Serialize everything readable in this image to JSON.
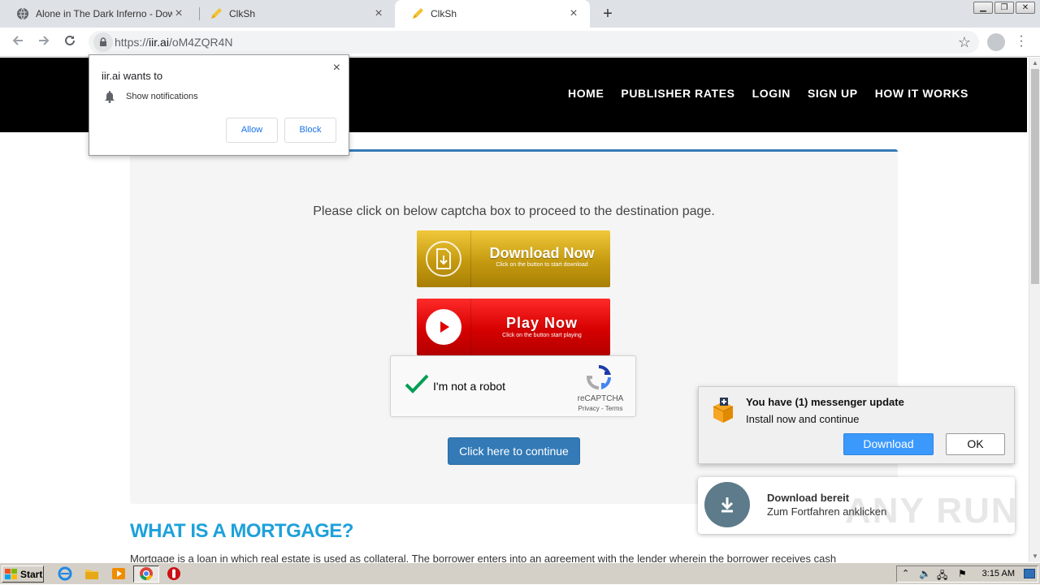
{
  "browser": {
    "tabs": [
      {
        "title": "Alone in The Dark Inferno - Download",
        "close": "×"
      },
      {
        "title": "ClkSh",
        "close": "×"
      },
      {
        "title": "ClkSh",
        "close": "×"
      }
    ],
    "new_tab": "+",
    "url_scheme": "https://",
    "url_host": "iir.ai",
    "url_path": "/oM4ZQR4N",
    "window_buttons": [
      "▁",
      "❐",
      "✕"
    ]
  },
  "site": {
    "nav": [
      "HOME",
      "PUBLISHER RATES",
      "LOGIN",
      "SIGN UP",
      "HOW IT WORKS"
    ]
  },
  "panel": {
    "instruction": "Please click on below captcha box to proceed to the destination page.",
    "download_btn": {
      "title": "Download Now",
      "subtitle": "Click on the button to start download"
    },
    "play_btn": {
      "title": "Play Now",
      "subtitle": "Click on the button start playing"
    },
    "captcha": {
      "label": "I'm not a robot",
      "brand": "reCAPTCHA",
      "terms": "Privacy - Terms"
    },
    "continue": "Click here to continue"
  },
  "article": {
    "heading": "WHAT IS A MORTGAGE?",
    "text": "Mortgage is a loan in which real estate is used as collateral. The borrower enters into an agreement with the lender wherein the borrower receives cash"
  },
  "permission": {
    "title": "iir.ai wants to",
    "text": "Show notifications",
    "allow": "Allow",
    "block": "Block",
    "close": "×"
  },
  "messenger": {
    "title": "You have (1) messenger update",
    "text": "Install now and continue",
    "download": "Download",
    "ok": "OK"
  },
  "ready": {
    "title": "Download bereit",
    "text": "Zum Fortfahren anklicken"
  },
  "watermark": "ANY RUN",
  "taskbar": {
    "start": "Start",
    "clock": "3:15 AM"
  },
  "colors": {
    "accent": "#337ab7",
    "heading": "#1ea1db",
    "header_bg": "#000000",
    "messenger_btn": "#3b99fc"
  }
}
